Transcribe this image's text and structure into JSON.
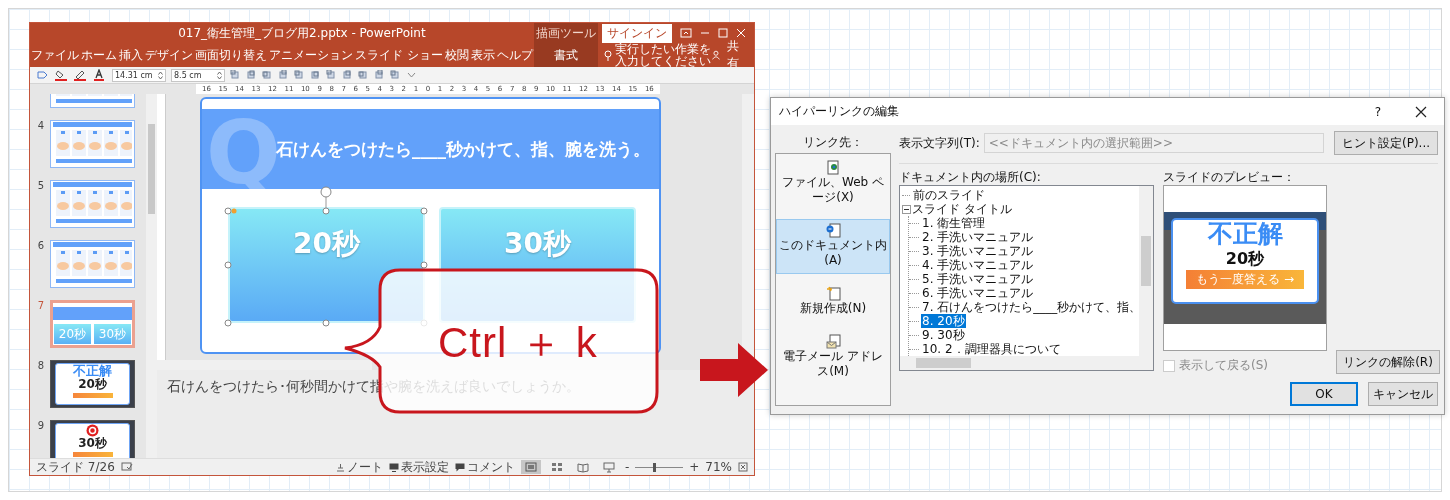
{
  "powerpoint": {
    "title": "017_衛生管理_ブログ用2.pptx  -  PowerPoint",
    "tool_group": "描画ツール",
    "sign_in": "サインイン",
    "ribbon_tabs": [
      {
        "label": "ファイル",
        "selected": false
      },
      {
        "label": "ホーム",
        "selected": false
      },
      {
        "label": "挿入",
        "selected": false
      },
      {
        "label": "デザイン",
        "selected": false
      },
      {
        "label": "画面切り替え",
        "selected": false
      },
      {
        "label": "アニメーション",
        "selected": false
      },
      {
        "label": "スライド ショー",
        "selected": false
      },
      {
        "label": "校閲",
        "selected": false
      },
      {
        "label": "表示",
        "selected": false
      },
      {
        "label": "ヘルプ",
        "selected": false
      },
      {
        "label": "書式",
        "selected": true
      }
    ],
    "tell_me": "実行したい作業を入力してください",
    "share": "共有",
    "shape_width": "14.31 cm",
    "shape_height": "8.5 cm",
    "ruler": [
      "16",
      "15",
      "14",
      "13",
      "12",
      "11",
      "10",
      "9",
      "8",
      "7",
      "6",
      "5",
      "4",
      "3",
      "2",
      "1",
      "0",
      "1",
      "2",
      "3",
      "4",
      "5",
      "6",
      "7",
      "8",
      "9",
      "10",
      "11",
      "12",
      "13",
      "14",
      "15",
      "16"
    ],
    "thumbnails": [
      {
        "kind": "manual",
        "selected": false
      },
      {
        "number": "4",
        "kind": "manual",
        "selected": false
      },
      {
        "number": "5",
        "kind": "manual",
        "selected": false
      },
      {
        "number": "6",
        "kind": "manual",
        "selected": false
      },
      {
        "number": "7",
        "kind": "quiz",
        "selected": true,
        "answers": [
          "20秒",
          "30秒"
        ]
      },
      {
        "number": "8",
        "kind": "result",
        "selected": false,
        "badge": "不正解",
        "answer": "20秒"
      },
      {
        "number": "9",
        "kind": "result",
        "selected": false,
        "answer": "30秒"
      }
    ],
    "slide": {
      "watermark": "Q",
      "title": "石けんをつけたら____秒かけて、指、腕を洗う。",
      "answers": [
        {
          "label": "20秒",
          "selected": true
        },
        {
          "label": "30秒",
          "selected": false
        }
      ]
    },
    "notes": "石けんをつけたら･何秒間かけて指や腕を洗えば良いでしょうか。",
    "status": {
      "slide_position": "スライド 7/26",
      "notes": "ノート",
      "display_settings": "表示設定",
      "comments": "コメント",
      "views": [
        {
          "kind": "normal",
          "selected": true
        },
        {
          "kind": "sorter",
          "selected": false
        },
        {
          "kind": "reading",
          "selected": false
        },
        {
          "kind": "slideshow",
          "selected": false
        }
      ],
      "zoom_out": "-",
      "zoom_in": "+",
      "zoom": {
        "level": 0.4,
        "reading": "71%"
      }
    }
  },
  "dialog": {
    "title": "ハイパーリンクの編集",
    "help": "?",
    "link_to": "リンク先：",
    "link_targets": [
      {
        "kind": "file",
        "label": "ファイル、Web ページ(X)",
        "selected": false
      },
      {
        "kind": "document",
        "label": "このドキュメント内(A)",
        "selected": true
      },
      {
        "kind": "new",
        "label": "新規作成(N)",
        "selected": false
      },
      {
        "kind": "email",
        "label": "電子メール アドレス(M)",
        "selected": false
      }
    ],
    "display_text_label": "表示文字列(T):",
    "display_text": {
      "value": "<<ドキュメント内の選択範囲>>",
      "disabled": true
    },
    "hint_button": "ヒント設定(P)...",
    "location_label": "ドキュメント内の場所(C):",
    "tree": [
      {
        "label": "前のスライド",
        "selected": false
      },
      {
        "label": "スライド タイトル",
        "selected": false,
        "expanded": true,
        "children": [
          {
            "label": "1. 衛生管理",
            "selected": false
          },
          {
            "label": "2. 手洗いマニュアル",
            "selected": false
          },
          {
            "label": "3. 手洗いマニュアル",
            "selected": false
          },
          {
            "label": "4. 手洗いマニュアル",
            "selected": false
          },
          {
            "label": "5. 手洗いマニュアル",
            "selected": false
          },
          {
            "label": "6. 手洗いマニュアル",
            "selected": false
          },
          {
            "label": "7. 石けんをつけたら____秒かけて、指、",
            "selected": false
          },
          {
            "label": "8. 20秒",
            "selected": true
          },
          {
            "label": "9. 30秒",
            "selected": false
          },
          {
            "label": "10. 2．調理器具について",
            "selected": false
          }
        ]
      }
    ],
    "preview_label": "スライドのプレビュー：",
    "preview": {
      "badge": "不正解",
      "answer": "20秒",
      "button": "もう一度答える →"
    },
    "show_and_return": {
      "label": "表示して戻る(S)",
      "checked": false,
      "disabled": true
    },
    "unlink_button": "リンクの解除(R)",
    "ok_button": "OK",
    "cancel_button": "キャンセル"
  },
  "callout": "Ctrl ＋ k"
}
